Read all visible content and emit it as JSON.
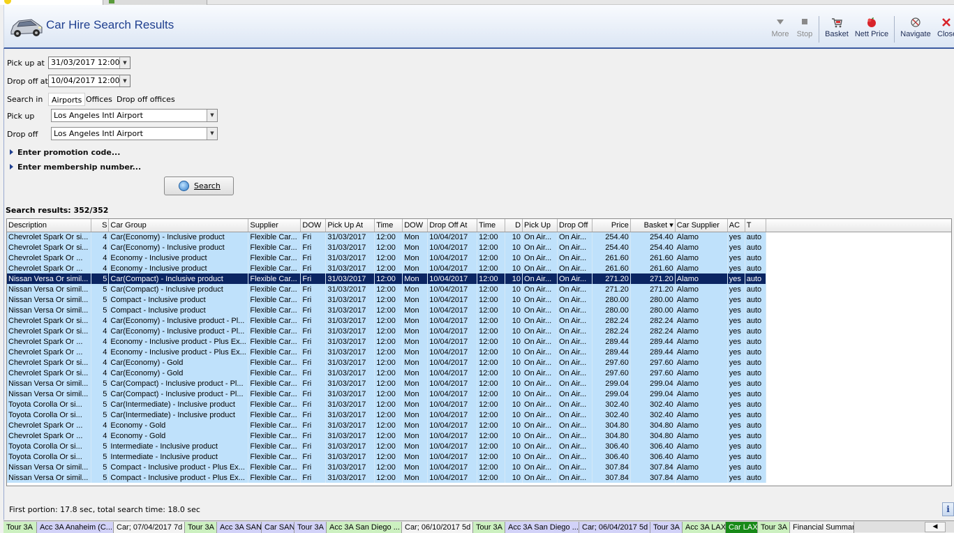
{
  "header": {
    "title": "Car Hire Search Results",
    "toolbar": {
      "more": "More",
      "stop": "Stop",
      "basket": "Basket",
      "nett_price": "Nett Price",
      "navigate": "Navigate",
      "close": "Close"
    }
  },
  "form": {
    "pickup_at_label": "Pick up at",
    "pickup_at_value": "31/03/2017 12:00",
    "dropoff_at_label": "Drop off at",
    "dropoff_at_value": "10/04/2017 12:00",
    "search_in_label": "Search in",
    "search_in_options": [
      "Airports",
      "Offices",
      "Drop off offices"
    ],
    "search_in_selected": "Airports",
    "pickup_label": "Pick up",
    "pickup_value": "Los Angeles Intl Airport",
    "dropoff_label": "Drop off",
    "dropoff_value": "Los Angeles Intl Airport",
    "promotion_label": "Enter promotion code...",
    "membership_label": "Enter membership number...",
    "search_button_label": "Search"
  },
  "results": {
    "count_label": "Search results: 352/352",
    "columns": [
      "Description",
      "S",
      "Car Group",
      "Supplier",
      "DOW",
      "Pick Up At",
      "Time",
      "DOW",
      "Drop Off At",
      "Time",
      "D",
      "Pick Up",
      "Drop Off",
      "Price",
      "Basket",
      "Car Supplier",
      "AC",
      "T"
    ],
    "selected_index": 4,
    "rows": [
      [
        "Chevrolet Spark Or si...",
        "4",
        "Car(Economy) - Inclusive product",
        "Flexible Car...",
        "Fri",
        "31/03/2017",
        "12:00",
        "Mon",
        "10/04/2017",
        "12:00",
        "10",
        "On Air...",
        "On Air...",
        "254.40",
        "254.40",
        "Alamo",
        "yes",
        "auto"
      ],
      [
        "Chevrolet Spark Or si...",
        "4",
        "Car(Economy) - Inclusive product",
        "Flexible Car...",
        "Fri",
        "31/03/2017",
        "12:00",
        "Mon",
        "10/04/2017",
        "12:00",
        "10",
        "On Air...",
        "On Air...",
        "254.40",
        "254.40",
        "Alamo",
        "yes",
        "auto"
      ],
      [
        "Chevrolet  Spark Or ...",
        "4",
        "Economy - Inclusive product",
        "Flexible Car...",
        "Fri",
        "31/03/2017",
        "12:00",
        "Mon",
        "10/04/2017",
        "12:00",
        "10",
        "On Air...",
        "On Air...",
        "261.60",
        "261.60",
        "Alamo",
        "yes",
        "auto"
      ],
      [
        "Chevrolet  Spark Or ...",
        "4",
        "Economy - Inclusive product",
        "Flexible Car...",
        "Fri",
        "31/03/2017",
        "12:00",
        "Mon",
        "10/04/2017",
        "12:00",
        "10",
        "On Air...",
        "On Air...",
        "261.60",
        "261.60",
        "Alamo",
        "yes",
        "auto"
      ],
      [
        "Nissan Versa Or simil...",
        "5",
        "Car(Compact) - Inclusive product",
        "Flexible Car...",
        "Fri",
        "31/03/2017",
        "12:00",
        "Mon",
        "10/04/2017",
        "12:00",
        "10",
        "On Air...",
        "On Air...",
        "271.20",
        "271.20",
        "Alamo",
        "yes",
        "auto"
      ],
      [
        "Nissan Versa Or simil...",
        "5",
        "Car(Compact) - Inclusive product",
        "Flexible Car...",
        "Fri",
        "31/03/2017",
        "12:00",
        "Mon",
        "10/04/2017",
        "12:00",
        "10",
        "On Air...",
        "On Air...",
        "271.20",
        "271.20",
        "Alamo",
        "yes",
        "auto"
      ],
      [
        "Nissan Versa Or simil...",
        "5",
        "Compact - Inclusive product",
        "Flexible Car...",
        "Fri",
        "31/03/2017",
        "12:00",
        "Mon",
        "10/04/2017",
        "12:00",
        "10",
        "On Air...",
        "On Air...",
        "280.00",
        "280.00",
        "Alamo",
        "yes",
        "auto"
      ],
      [
        "Nissan Versa Or simil...",
        "5",
        "Compact - Inclusive product",
        "Flexible Car...",
        "Fri",
        "31/03/2017",
        "12:00",
        "Mon",
        "10/04/2017",
        "12:00",
        "10",
        "On Air...",
        "On Air...",
        "280.00",
        "280.00",
        "Alamo",
        "yes",
        "auto"
      ],
      [
        "Chevrolet Spark Or si...",
        "4",
        "Car(Economy) - Inclusive product - Pl...",
        "Flexible Car...",
        "Fri",
        "31/03/2017",
        "12:00",
        "Mon",
        "10/04/2017",
        "12:00",
        "10",
        "On Air...",
        "On Air...",
        "282.24",
        "282.24",
        "Alamo",
        "yes",
        "auto"
      ],
      [
        "Chevrolet Spark Or si...",
        "4",
        "Car(Economy) - Inclusive product - Pl...",
        "Flexible Car...",
        "Fri",
        "31/03/2017",
        "12:00",
        "Mon",
        "10/04/2017",
        "12:00",
        "10",
        "On Air...",
        "On Air...",
        "282.24",
        "282.24",
        "Alamo",
        "yes",
        "auto"
      ],
      [
        "Chevrolet  Spark Or ...",
        "4",
        "Economy - Inclusive product - Plus Ex...",
        "Flexible Car...",
        "Fri",
        "31/03/2017",
        "12:00",
        "Mon",
        "10/04/2017",
        "12:00",
        "10",
        "On Air...",
        "On Air...",
        "289.44",
        "289.44",
        "Alamo",
        "yes",
        "auto"
      ],
      [
        "Chevrolet  Spark Or ...",
        "4",
        "Economy - Inclusive product - Plus Ex...",
        "Flexible Car...",
        "Fri",
        "31/03/2017",
        "12:00",
        "Mon",
        "10/04/2017",
        "12:00",
        "10",
        "On Air...",
        "On Air...",
        "289.44",
        "289.44",
        "Alamo",
        "yes",
        "auto"
      ],
      [
        "Chevrolet Spark Or si...",
        "4",
        "Car(Economy) - Gold",
        "Flexible Car...",
        "Fri",
        "31/03/2017",
        "12:00",
        "Mon",
        "10/04/2017",
        "12:00",
        "10",
        "On Air...",
        "On Air...",
        "297.60",
        "297.60",
        "Alamo",
        "yes",
        "auto"
      ],
      [
        "Chevrolet Spark Or si...",
        "4",
        "Car(Economy) - Gold",
        "Flexible Car...",
        "Fri",
        "31/03/2017",
        "12:00",
        "Mon",
        "10/04/2017",
        "12:00",
        "10",
        "On Air...",
        "On Air...",
        "297.60",
        "297.60",
        "Alamo",
        "yes",
        "auto"
      ],
      [
        "Nissan Versa Or simil...",
        "5",
        "Car(Compact) - Inclusive product - Pl...",
        "Flexible Car...",
        "Fri",
        "31/03/2017",
        "12:00",
        "Mon",
        "10/04/2017",
        "12:00",
        "10",
        "On Air...",
        "On Air...",
        "299.04",
        "299.04",
        "Alamo",
        "yes",
        "auto"
      ],
      [
        "Nissan Versa Or simil...",
        "5",
        "Car(Compact) - Inclusive product - Pl...",
        "Flexible Car...",
        "Fri",
        "31/03/2017",
        "12:00",
        "Mon",
        "10/04/2017",
        "12:00",
        "10",
        "On Air...",
        "On Air...",
        "299.04",
        "299.04",
        "Alamo",
        "yes",
        "auto"
      ],
      [
        "Toyota Corolla Or si...",
        "5",
        "Car(Intermediate) - Inclusive product",
        "Flexible Car...",
        "Fri",
        "31/03/2017",
        "12:00",
        "Mon",
        "10/04/2017",
        "12:00",
        "10",
        "On Air...",
        "On Air...",
        "302.40",
        "302.40",
        "Alamo",
        "yes",
        "auto"
      ],
      [
        "Toyota Corolla Or si...",
        "5",
        "Car(Intermediate) - Inclusive product",
        "Flexible Car...",
        "Fri",
        "31/03/2017",
        "12:00",
        "Mon",
        "10/04/2017",
        "12:00",
        "10",
        "On Air...",
        "On Air...",
        "302.40",
        "302.40",
        "Alamo",
        "yes",
        "auto"
      ],
      [
        "Chevrolet  Spark Or ...",
        "4",
        "Economy - Gold",
        "Flexible Car...",
        "Fri",
        "31/03/2017",
        "12:00",
        "Mon",
        "10/04/2017",
        "12:00",
        "10",
        "On Air...",
        "On Air...",
        "304.80",
        "304.80",
        "Alamo",
        "yes",
        "auto"
      ],
      [
        "Chevrolet  Spark Or ...",
        "4",
        "Economy - Gold",
        "Flexible Car...",
        "Fri",
        "31/03/2017",
        "12:00",
        "Mon",
        "10/04/2017",
        "12:00",
        "10",
        "On Air...",
        "On Air...",
        "304.80",
        "304.80",
        "Alamo",
        "yes",
        "auto"
      ],
      [
        "Toyota Corolla Or si...",
        "5",
        "Intermediate - Inclusive product",
        "Flexible Car...",
        "Fri",
        "31/03/2017",
        "12:00",
        "Mon",
        "10/04/2017",
        "12:00",
        "10",
        "On Air...",
        "On Air...",
        "306.40",
        "306.40",
        "Alamo",
        "yes",
        "auto"
      ],
      [
        "Toyota Corolla Or si...",
        "5",
        "Intermediate - Inclusive product",
        "Flexible Car...",
        "Fri",
        "31/03/2017",
        "12:00",
        "Mon",
        "10/04/2017",
        "12:00",
        "10",
        "On Air...",
        "On Air...",
        "306.40",
        "306.40",
        "Alamo",
        "yes",
        "auto"
      ],
      [
        "Nissan Versa Or simil...",
        "5",
        "Compact - Inclusive product - Plus Ex...",
        "Flexible Car...",
        "Fri",
        "31/03/2017",
        "12:00",
        "Mon",
        "10/04/2017",
        "12:00",
        "10",
        "On Air...",
        "On Air...",
        "307.84",
        "307.84",
        "Alamo",
        "yes",
        "auto"
      ],
      [
        "Nissan Versa Or simil...",
        "5",
        "Compact - Inclusive product - Plus Ex...",
        "Flexible Car...",
        "Fri",
        "31/03/2017",
        "12:00",
        "Mon",
        "10/04/2017",
        "12:00",
        "10",
        "On Air...",
        "On Air...",
        "307.84",
        "307.84",
        "Alamo",
        "yes",
        "auto"
      ]
    ]
  },
  "status": {
    "timing_text": "First portion: 17.8 sec, total search time: 18.0 sec"
  },
  "bottom_tabs": [
    {
      "label": "Tour 3A",
      "color": "green"
    },
    {
      "label": "Acc 3A Anaheim (C...",
      "color": "purple"
    },
    {
      "label": "Car; 07/04/2017 7d",
      "color": "white"
    },
    {
      "label": "Tour 3A",
      "color": "green"
    },
    {
      "label": "Acc 3A SAN",
      "color": "purple"
    },
    {
      "label": "Car SAN",
      "color": "purple"
    },
    {
      "label": "Tour 3A",
      "color": "purple"
    },
    {
      "label": "Acc 3A San Diego ...",
      "color": "green"
    },
    {
      "label": "Car; 06/10/2017 5d",
      "color": "white"
    },
    {
      "label": "Tour 3A",
      "color": "green"
    },
    {
      "label": "Acc 3A San Diego ...",
      "color": "purple"
    },
    {
      "label": "Car; 06/04/2017 5d",
      "color": "purple"
    },
    {
      "label": "Tour 3A",
      "color": "purple"
    },
    {
      "label": "Acc 3A LAX",
      "color": "green"
    },
    {
      "label": "Car LAX",
      "color": "active"
    },
    {
      "label": "Tour 3A",
      "color": "green"
    },
    {
      "label": "Financial Summary",
      "color": "white"
    }
  ],
  "colors": {
    "title": "#1f3f8f",
    "row_background": "#bfe1fb",
    "row_selected": "#0b2562",
    "active_tab": "#178a17"
  }
}
